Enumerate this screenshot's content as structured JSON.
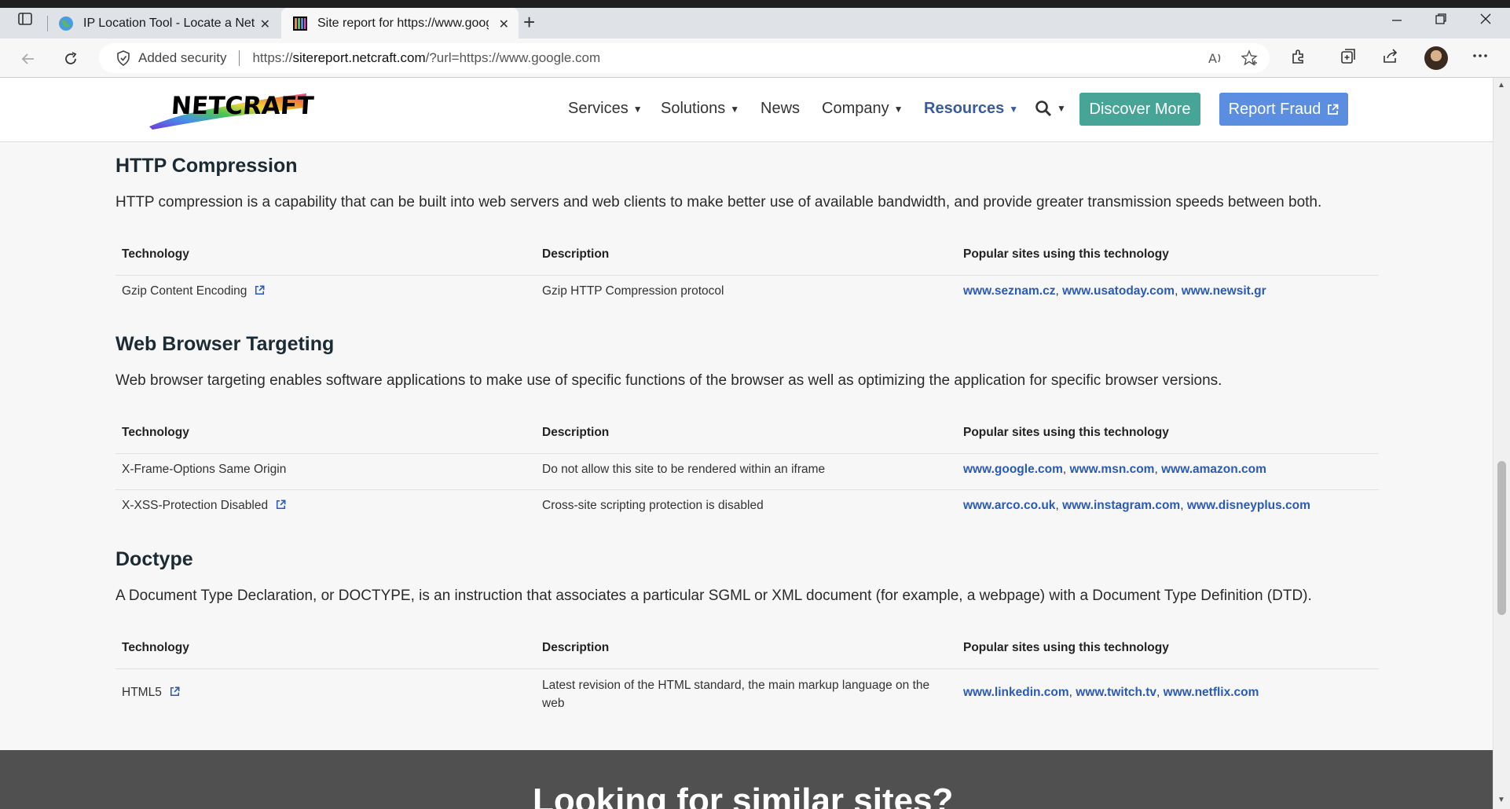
{
  "browser": {
    "tabs": [
      {
        "title": "IP Location Tool - Locate a Network",
        "icon": "globe-icon",
        "close": "✕"
      },
      {
        "title": "Site report for https://www.google.com",
        "icon": "netcraft-favicon",
        "close": "✕"
      }
    ],
    "new_tab": "+",
    "address": {
      "security_label": "Added security",
      "url_prefix": "https://",
      "url_domain": "sitereport.netcraft.com",
      "url_rest": "/?url=https://www.google.com"
    }
  },
  "site": {
    "logo_text": "NETCRAFT",
    "nav": [
      {
        "label": "Services",
        "dropdown": true
      },
      {
        "label": "Solutions",
        "dropdown": true
      },
      {
        "label": "News",
        "dropdown": false
      },
      {
        "label": "Company",
        "dropdown": true
      },
      {
        "label": "Resources",
        "dropdown": true
      }
    ],
    "discover_label": "Discover More",
    "report_label": "Report Fraud"
  },
  "sections": [
    {
      "title": "HTTP Compression",
      "description": "HTTP compression is a capability that can be built into web servers and web clients to make better use of available bandwidth, and provide greater transmission speeds between both.",
      "headers": [
        "Technology",
        "Description",
        "Popular sites using this technology"
      ],
      "rows": [
        {
          "technology": "Gzip Content Encoding",
          "external": true,
          "description": "Gzip HTTP Compression protocol",
          "sites": [
            "www.seznam.cz",
            "www.usatoday.com",
            "www.newsit.gr"
          ]
        }
      ]
    },
    {
      "title": "Web Browser Targeting",
      "description": "Web browser targeting enables software applications to make use of specific functions of the browser as well as optimizing the application for specific browser versions.",
      "headers": [
        "Technology",
        "Description",
        "Popular sites using this technology"
      ],
      "rows": [
        {
          "technology": "X-Frame-Options Same Origin",
          "external": false,
          "description": "Do not allow this site to be rendered within an iframe",
          "sites": [
            "www.google.com",
            "www.msn.com",
            "www.amazon.com"
          ]
        },
        {
          "technology": "X-XSS-Protection Disabled",
          "external": true,
          "description": "Cross-site scripting protection is disabled",
          "sites": [
            "www.arco.co.uk",
            "www.instagram.com",
            "www.disneyplus.com"
          ]
        }
      ]
    },
    {
      "title": "Doctype",
      "description": "A Document Type Declaration, or DOCTYPE, is an instruction that associates a particular SGML or XML document (for example, a webpage) with a Document Type Definition (DTD).",
      "headers": [
        "Technology",
        "Description",
        "Popular sites using this technology"
      ],
      "rows": [
        {
          "technology": "HTML5",
          "external": true,
          "description_line1": "Latest revision of the HTML standard, the main markup language on the",
          "description_line2": "web",
          "sites": [
            "www.linkedin.com",
            "www.twitch.tv",
            "www.netflix.com"
          ]
        }
      ]
    }
  ],
  "footer": {
    "heading": "Looking for similar sites?"
  },
  "colors": {
    "teal": "#46a597",
    "blue": "#5b8de0",
    "link": "#2b5ab6",
    "nav_active": "#3a5b9c"
  }
}
